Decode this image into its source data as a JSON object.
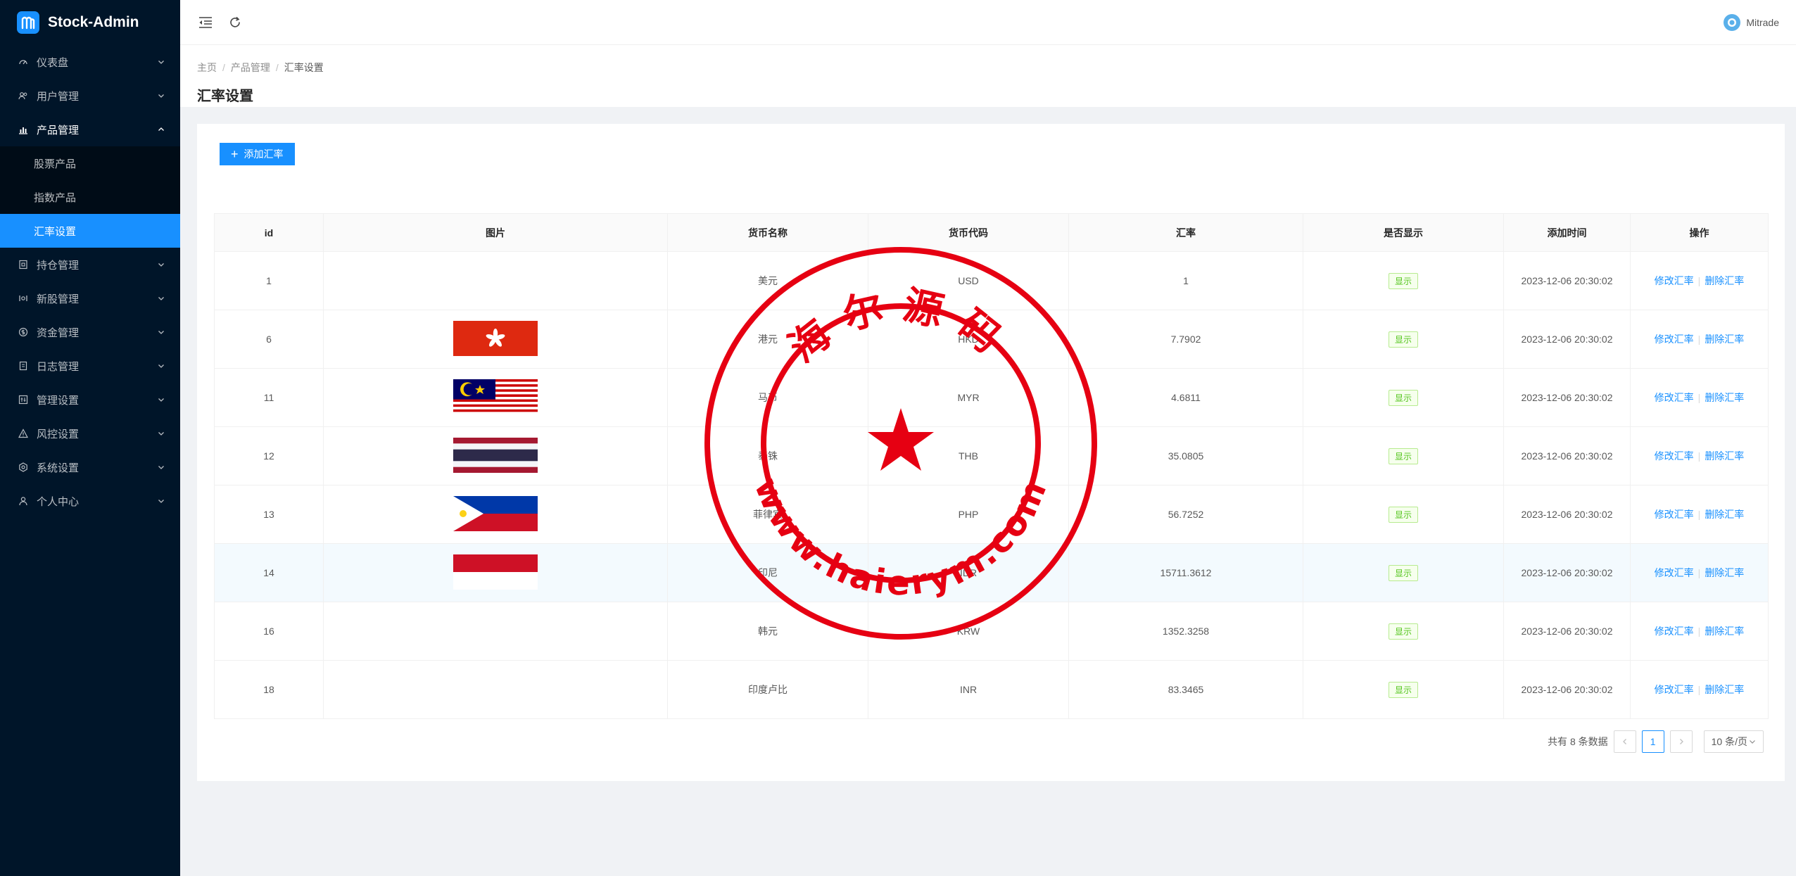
{
  "app": {
    "title": "Stock-Admin"
  },
  "sidebar": {
    "items": [
      {
        "label": "仪表盘",
        "icon": "dashboard-icon"
      },
      {
        "label": "用户管理",
        "icon": "users-icon"
      },
      {
        "label": "产品管理",
        "icon": "bar-chart-icon",
        "open": true,
        "children": [
          {
            "label": "股票产品"
          },
          {
            "label": "指数产品"
          },
          {
            "label": "汇率设置",
            "active": true
          }
        ]
      },
      {
        "label": "持仓管理",
        "icon": "position-icon"
      },
      {
        "label": "新股管理",
        "icon": "ipo-icon"
      },
      {
        "label": "资金管理",
        "icon": "money-icon"
      },
      {
        "label": "日志管理",
        "icon": "log-icon"
      },
      {
        "label": "管理设置",
        "icon": "admin-settings-icon"
      },
      {
        "label": "风控设置",
        "icon": "warning-icon"
      },
      {
        "label": "系统设置",
        "icon": "gear-icon"
      },
      {
        "label": "个人中心",
        "icon": "user-icon"
      }
    ]
  },
  "header": {
    "username": "Mitrade"
  },
  "breadcrumb": {
    "home": "主页",
    "section": "产品管理",
    "current": "汇率设置"
  },
  "page": {
    "title": "汇率设置",
    "add_button": "添加汇率"
  },
  "table": {
    "columns": [
      "id",
      "图片",
      "货币名称",
      "货币代码",
      "汇率",
      "是否显示",
      "添加时间",
      "操作"
    ],
    "rows": [
      {
        "id": "1",
        "flag": "",
        "name": "美元",
        "code": "USD",
        "rate": "1",
        "status": "显示",
        "time": "2023-12-06 20:30:02"
      },
      {
        "id": "6",
        "flag": "hk",
        "name": "港元",
        "code": "HKD",
        "rate": "7.7902",
        "status": "显示",
        "time": "2023-12-06 20:30:02"
      },
      {
        "id": "11",
        "flag": "my",
        "name": "马币",
        "code": "MYR",
        "rate": "4.6811",
        "status": "显示",
        "time": "2023-12-06 20:30:02"
      },
      {
        "id": "12",
        "flag": "th",
        "name": "泰铢",
        "code": "THB",
        "rate": "35.0805",
        "status": "显示",
        "time": "2023-12-06 20:30:02"
      },
      {
        "id": "13",
        "flag": "ph",
        "name": "菲律宾",
        "code": "PHP",
        "rate": "56.7252",
        "status": "显示",
        "time": "2023-12-06 20:30:02"
      },
      {
        "id": "14",
        "flag": "id",
        "name": "印尼",
        "code": "IDR",
        "rate": "15711.3612",
        "status": "显示",
        "time": "2023-12-06 20:30:02",
        "highlight": true
      },
      {
        "id": "16",
        "flag": "",
        "name": "韩元",
        "code": "KRW",
        "rate": "1352.3258",
        "status": "显示",
        "time": "2023-12-06 20:30:02"
      },
      {
        "id": "18",
        "flag": "",
        "name": "印度卢比",
        "code": "INR",
        "rate": "83.3465",
        "status": "显示",
        "time": "2023-12-06 20:30:02"
      }
    ],
    "actions": {
      "edit": "修改汇率",
      "delete": "删除汇率"
    }
  },
  "pagination": {
    "total_text": "共有 8 条数据",
    "current_page": "1",
    "page_size": "10 条/页"
  },
  "watermark": {
    "top_text": "海尔源码",
    "bottom_text": "www.haierym.com",
    "color": "#e60012"
  }
}
